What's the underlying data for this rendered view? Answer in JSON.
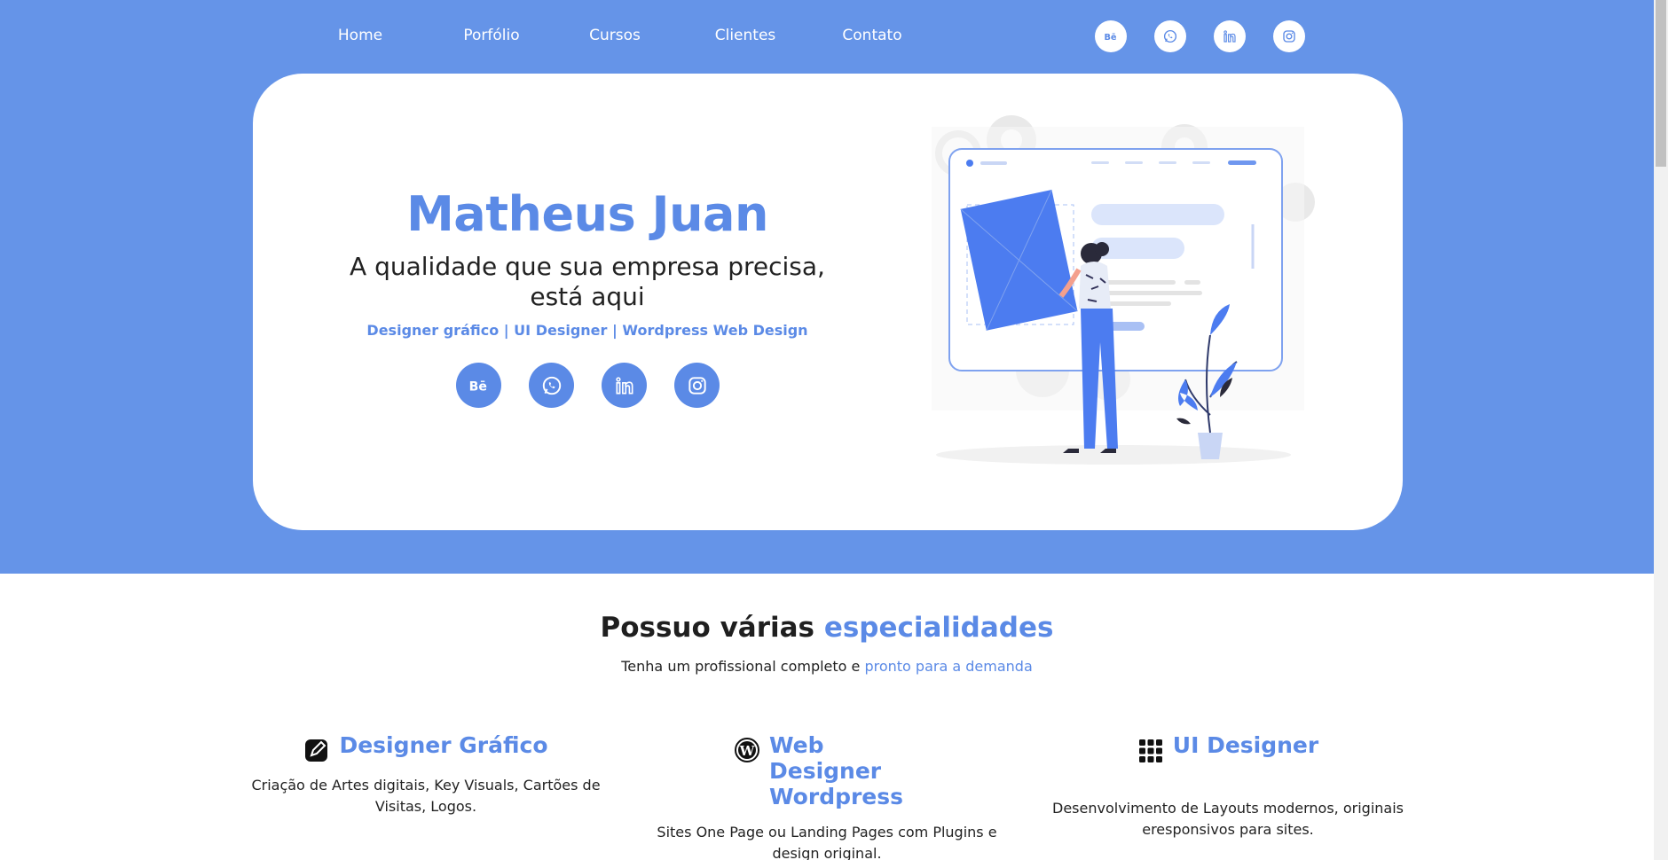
{
  "nav": {
    "items": [
      "Home",
      "Porfólio",
      "Cursos",
      "Clientes",
      "Contato"
    ],
    "social_icons": [
      "behance-icon",
      "whatsapp-icon",
      "linkedin-icon",
      "instagram-icon"
    ]
  },
  "hero": {
    "name": "Matheus Juan",
    "tagline": "A qualidade que sua empresa precisa, está aqui",
    "roles": "Designer gráfico | UI Designer | Wordpress Web Design",
    "social_icons": [
      "behance-icon",
      "whatsapp-icon",
      "linkedin-icon",
      "instagram-icon"
    ]
  },
  "specialties": {
    "title_plain": "Possuo várias ",
    "title_accent": "especialidades",
    "subtitle_plain": "Tenha um profissional completo e ",
    "subtitle_accent": "pronto para a demanda",
    "services": [
      {
        "icon": "pen-square-icon",
        "title": "Designer Gráfico",
        "description": "Criação de Artes digitais, Key Visuals, Cartões de Visitas, Logos."
      },
      {
        "icon": "wordpress-icon",
        "title": "Web Designer Wordpress",
        "description": "Sites One Page ou Landing Pages com Plugins e design original."
      },
      {
        "icon": "grid-dots-icon",
        "title": "UI Designer",
        "description": "Desenvolvimento de Layouts modernos, originais eresponsivos para sites."
      }
    ]
  },
  "colors": {
    "band": "#6594e8",
    "accent": "#5b8ae6",
    "card": "#ffffff"
  }
}
